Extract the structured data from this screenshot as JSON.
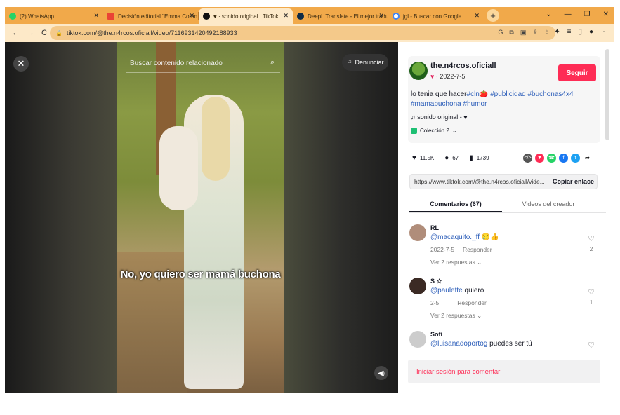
{
  "browser": {
    "tabs": [
      {
        "label": "(2) WhatsApp",
        "color": "#25d366"
      },
      {
        "label": "Decisión editorial \"Emma Coron...",
        "color": "#ea4335"
      },
      {
        "label": "♥ · sonido original | TikTok",
        "color": "#111111"
      },
      {
        "label": "DeepL Translate - El mejor tradu...",
        "color": "#0f2b46"
      },
      {
        "label": "jgl - Buscar con Google",
        "color": "#4285f4"
      }
    ],
    "new_tab": "+",
    "url": "tiktok.com/@the.n4rcos.oficiall/video/7116931420492188933"
  },
  "video": {
    "search_placeholder": "Buscar contenido relacionado",
    "report_label": "Denunciar",
    "caption": "No, yo quiero ser mamá buchona"
  },
  "post": {
    "username": "the.n4rcos.oficiall",
    "date": "· 2022-7-5",
    "follow_label": "Seguir",
    "description_text": "lo tenia que hacer",
    "description_tags": [
      "#cln🍅",
      "#publicidad",
      "#buchonas4x4",
      "#mamabuchona",
      "#humor"
    ],
    "sound": "sonido original - ♥",
    "collection": "Colección 2",
    "likes": "11.5K",
    "comments_count": "67",
    "saves": "1739",
    "link": "https://www.tiktok.com/@the.n4rcos.oficiall/vide...",
    "copy_label": "Copiar enlace",
    "tab_comments": "Comentarios (67)",
    "tab_creator": "Videos del creador"
  },
  "comments": [
    {
      "name": "RL",
      "mention": "@macaquito._ff",
      "text": " 😢👍",
      "date": "2022-7-5",
      "reply": "Responder",
      "replies": "Ver 2 respuestas",
      "likes": "2"
    },
    {
      "name": "S ☆",
      "mention": "@paulette",
      "text": " quiero",
      "date": "2-5",
      "reply": "Responder",
      "replies": "Ver 2 respuestas",
      "likes": "1"
    },
    {
      "name": "Sofi",
      "mention": "@luisanadoportog",
      "text": " puedes ser tú",
      "date": "",
      "reply": "",
      "replies": "",
      "likes": ""
    }
  ],
  "login_prompt": "Iniciar sesión para comentar",
  "colors": {
    "accent": "#fe2c55",
    "tab_strip": "#f1a94a",
    "link": "#2b5db9"
  }
}
